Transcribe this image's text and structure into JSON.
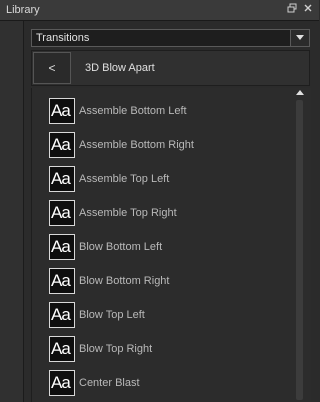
{
  "window": {
    "title": "Library",
    "buttons": [
      "restore-icon",
      "close-icon"
    ]
  },
  "dropdown": {
    "value": "Transitions"
  },
  "nav": {
    "back_label": "<",
    "breadcrumb": "3D Blow Apart"
  },
  "items": [
    {
      "thumb": "Aa",
      "label": "Assemble Bottom Left"
    },
    {
      "thumb": "Aa",
      "label": "Assemble Bottom Right"
    },
    {
      "thumb": "Aa",
      "label": "Assemble Top Left"
    },
    {
      "thumb": "Aa",
      "label": "Assemble Top Right"
    },
    {
      "thumb": "Aa",
      "label": "Blow Bottom Left"
    },
    {
      "thumb": "Aa",
      "label": "Blow Bottom Right"
    },
    {
      "thumb": "Aa",
      "label": "Blow Top Left"
    },
    {
      "thumb": "Aa",
      "label": "Blow Top Right"
    },
    {
      "thumb": "Aa",
      "label": "Center Blast"
    }
  ]
}
